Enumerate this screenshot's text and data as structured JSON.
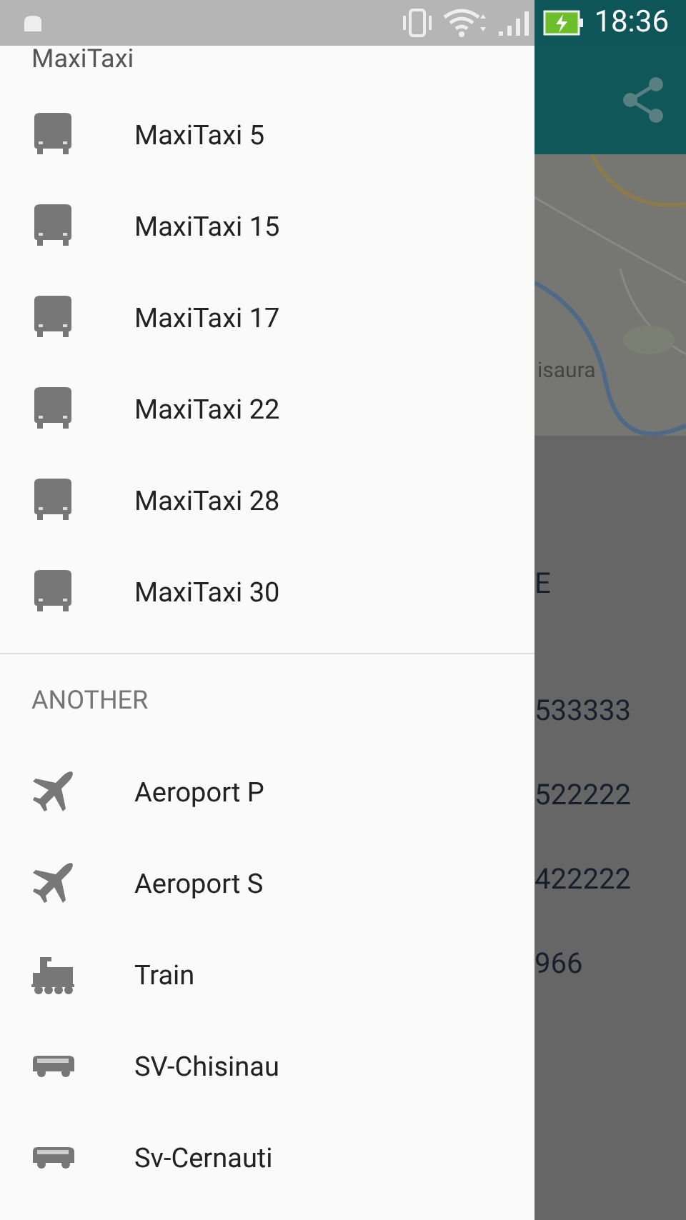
{
  "status_bar": {
    "time": "18:36"
  },
  "drawer": {
    "header": "MaxiTaxi",
    "sections": [
      {
        "items": [
          {
            "label": "MaxiTaxi 5",
            "kind": "bus"
          },
          {
            "label": "MaxiTaxi 15",
            "kind": "bus"
          },
          {
            "label": "MaxiTaxi 17",
            "kind": "bus"
          },
          {
            "label": "MaxiTaxi 22",
            "kind": "bus"
          },
          {
            "label": "MaxiTaxi 28",
            "kind": "bus"
          },
          {
            "label": "MaxiTaxi 30",
            "kind": "bus"
          }
        ]
      },
      {
        "title": "ANOTHER",
        "items": [
          {
            "label": "Aeroport P",
            "kind": "plane"
          },
          {
            "label": "Aeroport S",
            "kind": "plane"
          },
          {
            "label": "Train",
            "kind": "train"
          },
          {
            "label": "SV-Chisinau",
            "kind": "van"
          },
          {
            "label": "Sv-Cernauti",
            "kind": "van"
          }
        ]
      }
    ]
  },
  "background": {
    "map_label": "isaura",
    "heading": "E",
    "phones": [
      "533333",
      "522222",
      "422222",
      "966"
    ]
  }
}
